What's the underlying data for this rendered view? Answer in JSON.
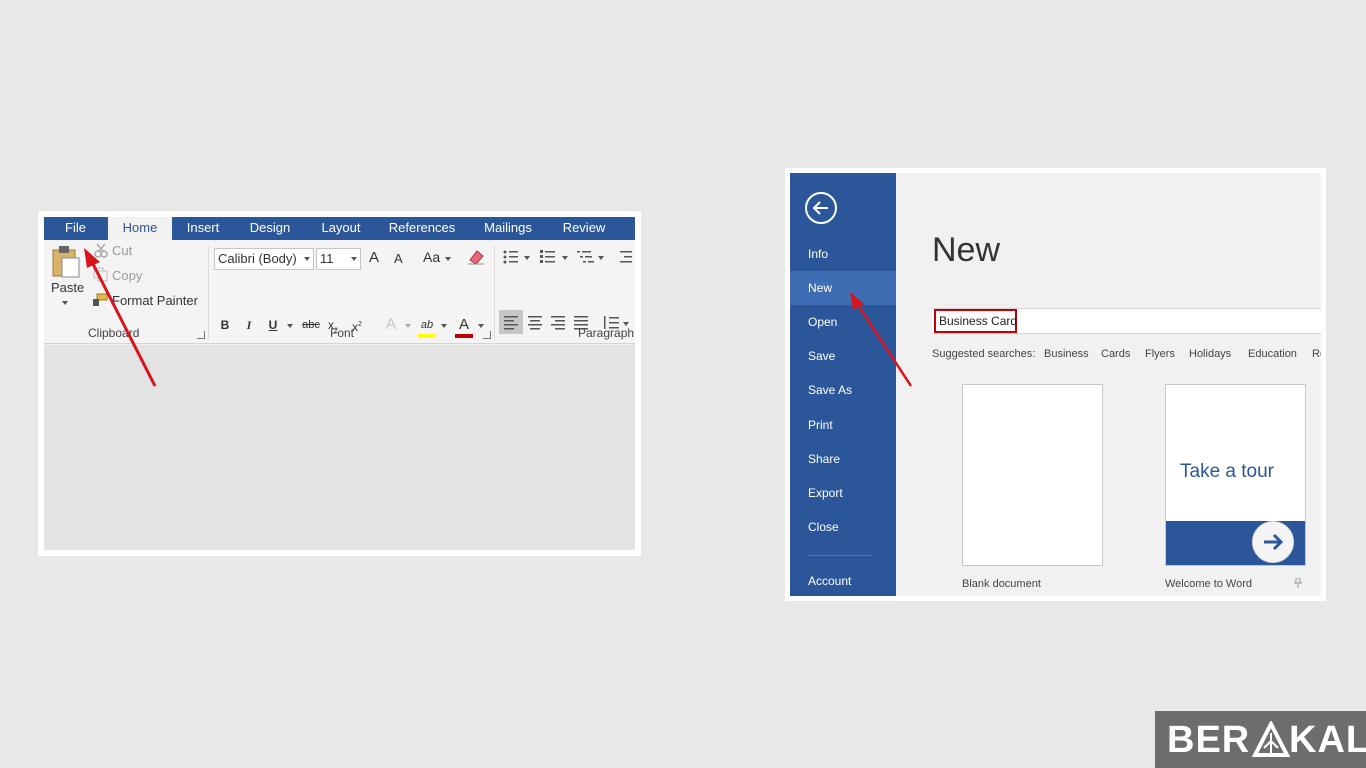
{
  "ribbon": {
    "tabs": [
      "File",
      "Home",
      "Insert",
      "Design",
      "Layout",
      "References",
      "Mailings",
      "Review"
    ],
    "clipboard": {
      "paste_label": "Paste",
      "cut_label": "Cut",
      "copy_label": "Copy",
      "format_painter_label": "Format Painter",
      "group_label": "Clipboard"
    },
    "font": {
      "font_name": "Calibri (Body)",
      "font_size": "11",
      "grow_label": "A",
      "shrink_label": "A",
      "change_case_label": "Aa",
      "bold_label": "B",
      "italic_label": "I",
      "underline_label": "U",
      "strike_label": "abc",
      "subscript_label": "x",
      "superscript_label": "x",
      "text_effects_label": "A",
      "highlight_label": "ab",
      "font_color_label": "A",
      "group_label": "Font"
    },
    "paragraph": {
      "group_label": "Paragraph"
    }
  },
  "backstage": {
    "menu": [
      "Info",
      "New",
      "Open",
      "Save",
      "Save As",
      "Print",
      "Share",
      "Export",
      "Close"
    ],
    "account_label": "Account",
    "active_item": "New",
    "title": "New",
    "search_value": "Business Card",
    "suggested_label": "Suggested searches:",
    "suggested": [
      "Business",
      "Cards",
      "Flyers",
      "Holidays",
      "Education",
      "Re"
    ],
    "templates": [
      {
        "label": "Blank document"
      },
      {
        "label": "Welcome to Word",
        "heading": "Take a tour"
      }
    ]
  },
  "watermark": {
    "text_left": "BER",
    "text_right": "KAL"
  },
  "colors": {
    "word_blue": "#2b579a",
    "menu_active": "#3f6db3",
    "highlight_red": "#c00000",
    "arrow_red": "#d8141c"
  }
}
